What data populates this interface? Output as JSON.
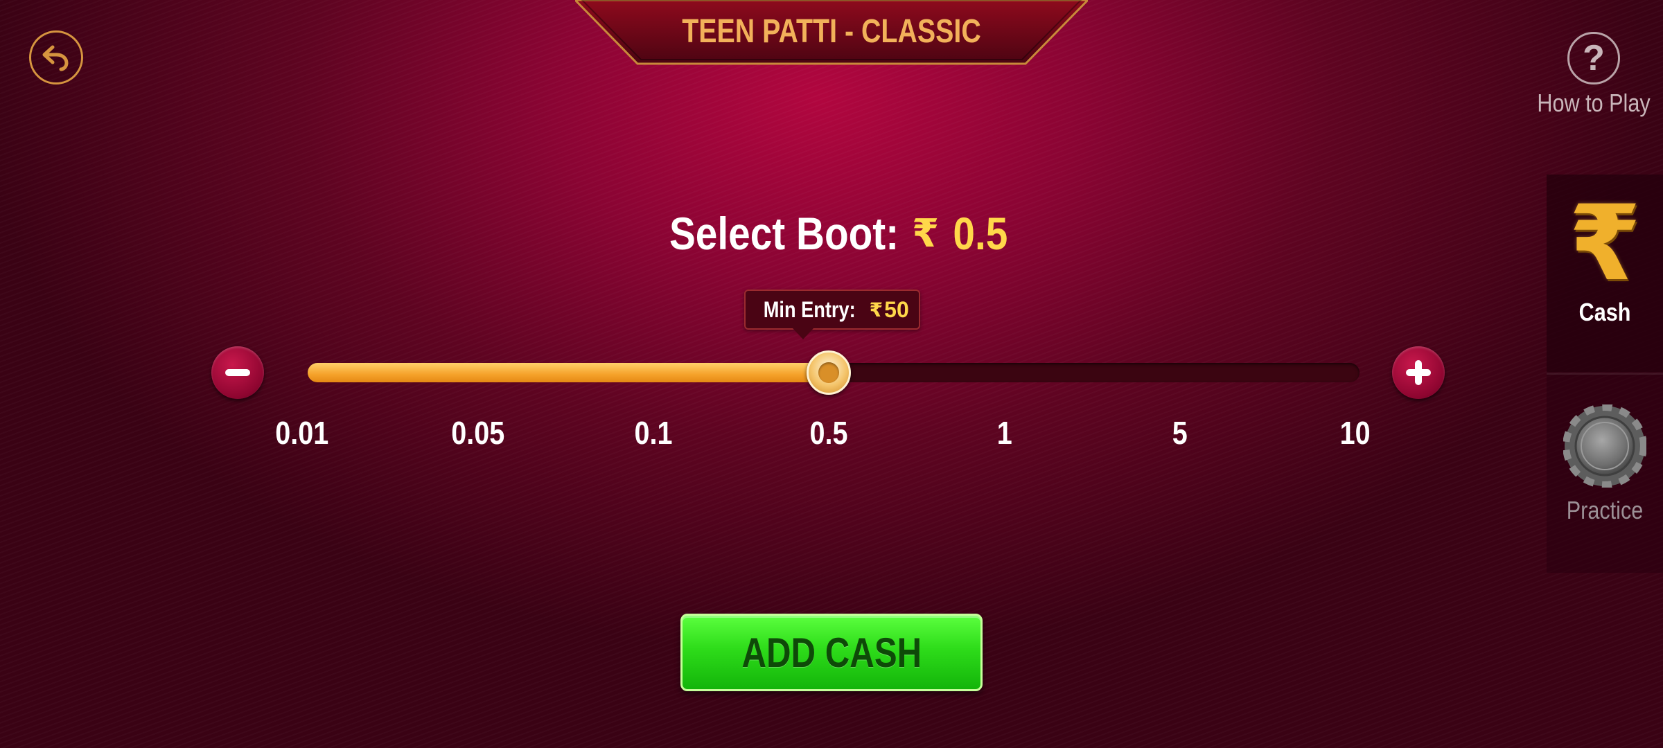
{
  "header": {
    "title": "TEEN PATTI - CLASSIC",
    "back_icon": "back-arrow-icon"
  },
  "help": {
    "icon": "question-mark-icon",
    "glyph": "?",
    "label": "How to Play"
  },
  "side_tabs": [
    {
      "label": "Cash",
      "icon": "rupee-icon",
      "glyph": "₹",
      "active": true
    },
    {
      "label": "Practice",
      "icon": "poker-chip-icon",
      "active": false
    }
  ],
  "boot": {
    "label": "Select Boot:",
    "currency": "₹",
    "value": "0.5"
  },
  "tooltip": {
    "label": "Min Entry:",
    "currency": "₹",
    "value": "50"
  },
  "slider": {
    "ticks": [
      "0.01",
      "0.05",
      "0.1",
      "0.5",
      "1",
      "5",
      "10"
    ],
    "selected_index": 3,
    "minus_icon": "minus-icon",
    "plus_icon": "plus-icon"
  },
  "actions": {
    "add_cash_label": "ADD CASH"
  },
  "colors": {
    "accent_gold": "#f2b15a",
    "value_yellow": "#ffd84a",
    "button_green": "#2edc1a",
    "background": "#8a0433"
  }
}
